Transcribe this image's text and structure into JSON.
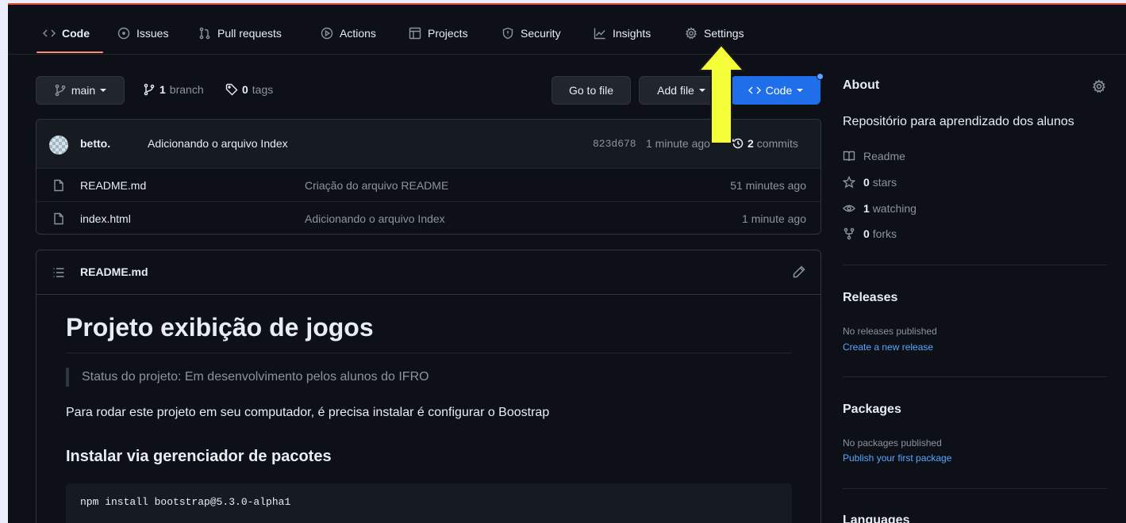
{
  "tabs": [
    {
      "label": "Code",
      "icon": "code-icon"
    },
    {
      "label": "Issues",
      "icon": "issue-icon"
    },
    {
      "label": "Pull requests",
      "icon": "pull-request-icon"
    },
    {
      "label": "Actions",
      "icon": "play-icon"
    },
    {
      "label": "Projects",
      "icon": "table-icon"
    },
    {
      "label": "Security",
      "icon": "shield-icon"
    },
    {
      "label": "Insights",
      "icon": "graph-icon"
    },
    {
      "label": "Settings",
      "icon": "gear-icon"
    }
  ],
  "branchbar": {
    "branch": "main",
    "branch_count": "1",
    "branch_word": "branch",
    "tag_count": "0",
    "tag_word": "tags",
    "go_to_file": "Go to file",
    "add_file": "Add file",
    "code": "Code"
  },
  "commit": {
    "author": "betto.",
    "message": "Adicionando o arquivo Index",
    "hash": "823d678",
    "time": "1 minute ago",
    "commit_count": "2",
    "commit_word": "commits"
  },
  "files": [
    {
      "name": "README.md",
      "message": "Criação do arquivo README",
      "time": "51 minutes ago"
    },
    {
      "name": "index.html",
      "message": "Adicionando o arquivo Index",
      "time": "1 minute ago"
    }
  ],
  "readme": {
    "filename": "README.md",
    "heading": "Projeto exibição de jogos",
    "quote": "Status do projeto: Em desenvolvimento pelos alunos do IFRO",
    "paragraph": "Para rodar este projeto em seu computador, é precisa instalar é configurar o Boostrap",
    "subheading": "Instalar via gerenciador de pacotes",
    "code": "npm install bootstrap@5.3.0-alpha1"
  },
  "about": {
    "title": "About",
    "description": "Repositório para aprendizado dos alunos",
    "readme": "Readme",
    "stars_count": "0",
    "stars_word": "stars",
    "watching_count": "1",
    "watching_word": "watching",
    "forks_count": "0",
    "forks_word": "forks"
  },
  "releases": {
    "title": "Releases",
    "empty": "No releases published",
    "link": "Create a new release"
  },
  "packages": {
    "title": "Packages",
    "empty": "No packages published",
    "link": "Publish your first package"
  },
  "languages": {
    "title": "Languages"
  },
  "colors": {
    "accent_blue": "#1f6feb",
    "tab_underline": "#fd8c73",
    "annotation_arrow": "#f4ff3a"
  }
}
